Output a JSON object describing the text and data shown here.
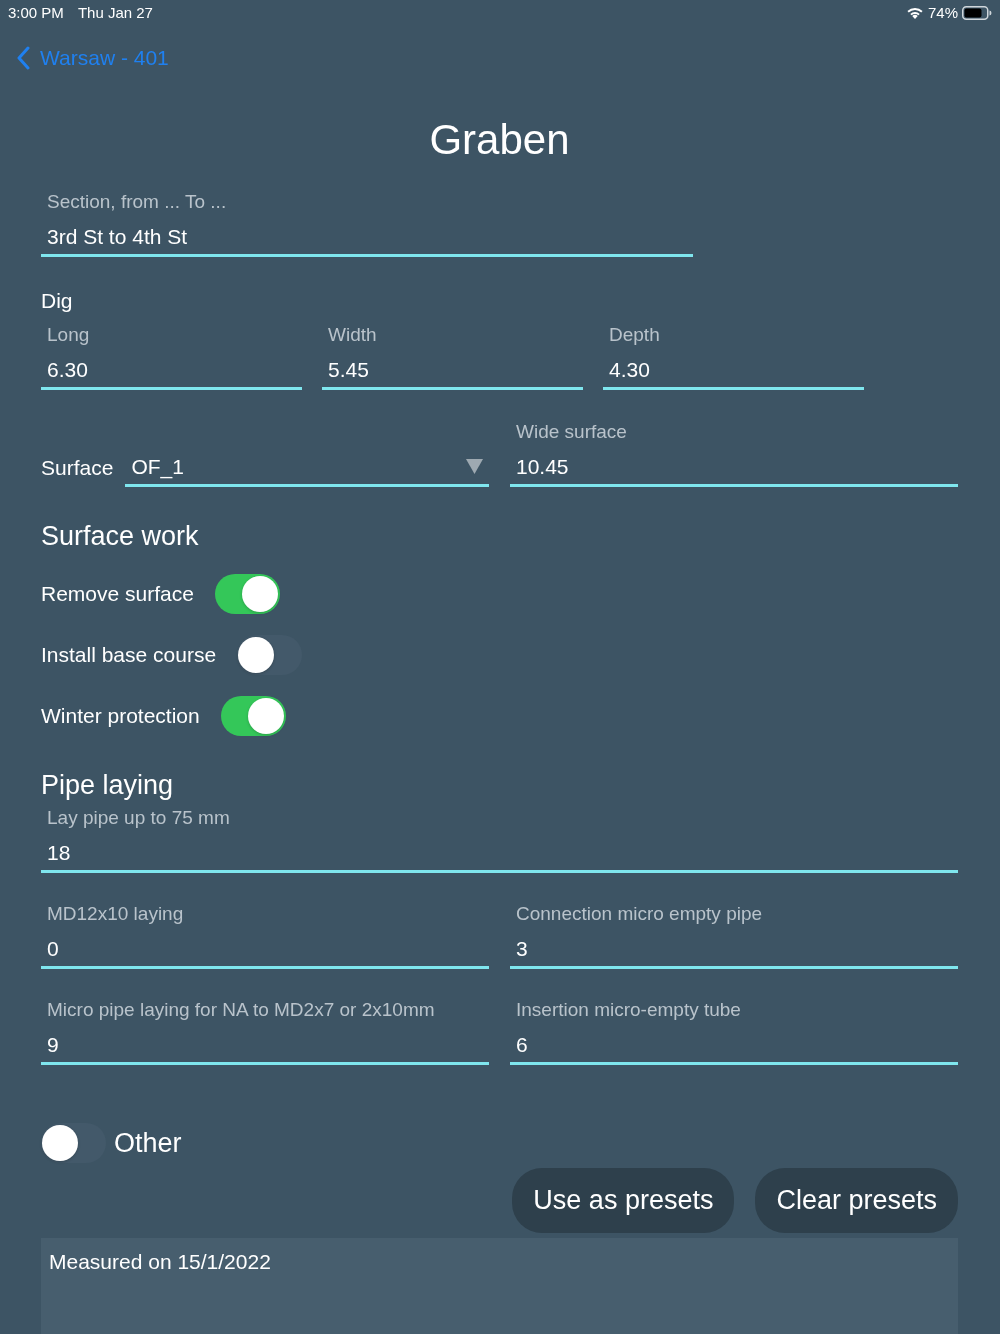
{
  "status_bar": {
    "time": "3:00 PM",
    "date": "Thu Jan 27",
    "battery": "74%"
  },
  "nav": {
    "back_label": "Warsaw - 401"
  },
  "title": "Graben",
  "section_field": {
    "label": "Section, from ... To ...",
    "value": "3rd St to 4th St"
  },
  "dig": {
    "heading": "Dig",
    "fields": [
      {
        "label": "Long",
        "value": "6.30"
      },
      {
        "label": "Width",
        "value": "5.45"
      },
      {
        "label": "Depth",
        "value": "4.30"
      }
    ]
  },
  "surface": {
    "label": "Surface",
    "dropdown_value": "OF_1",
    "wide_surface": {
      "label": "Wide surface",
      "value": "10.45"
    }
  },
  "surface_work": {
    "heading": "Surface work",
    "toggles": [
      {
        "label": "Remove surface",
        "on": true
      },
      {
        "label": "Install base course",
        "on": false
      },
      {
        "label": "Winter protection",
        "on": true
      }
    ]
  },
  "pipe_laying": {
    "heading": "Pipe laying",
    "lay_pipe": {
      "label": "Lay pipe up to 75 mm",
      "value": "18"
    },
    "fields": [
      {
        "label": "MD12x10 laying",
        "value": "0"
      },
      {
        "label": "Connection micro empty pipe",
        "value": "3"
      },
      {
        "label": "Micro pipe laying for NA to MD2x7 or 2x10mm",
        "value": "9"
      },
      {
        "label": "Insertion micro-empty tube",
        "value": "6"
      }
    ]
  },
  "other": {
    "label": "Other",
    "on": false
  },
  "buttons": [
    "Use as presets",
    "Clear presets"
  ],
  "notes": {
    "value": "Measured on 15/1/2022"
  }
}
